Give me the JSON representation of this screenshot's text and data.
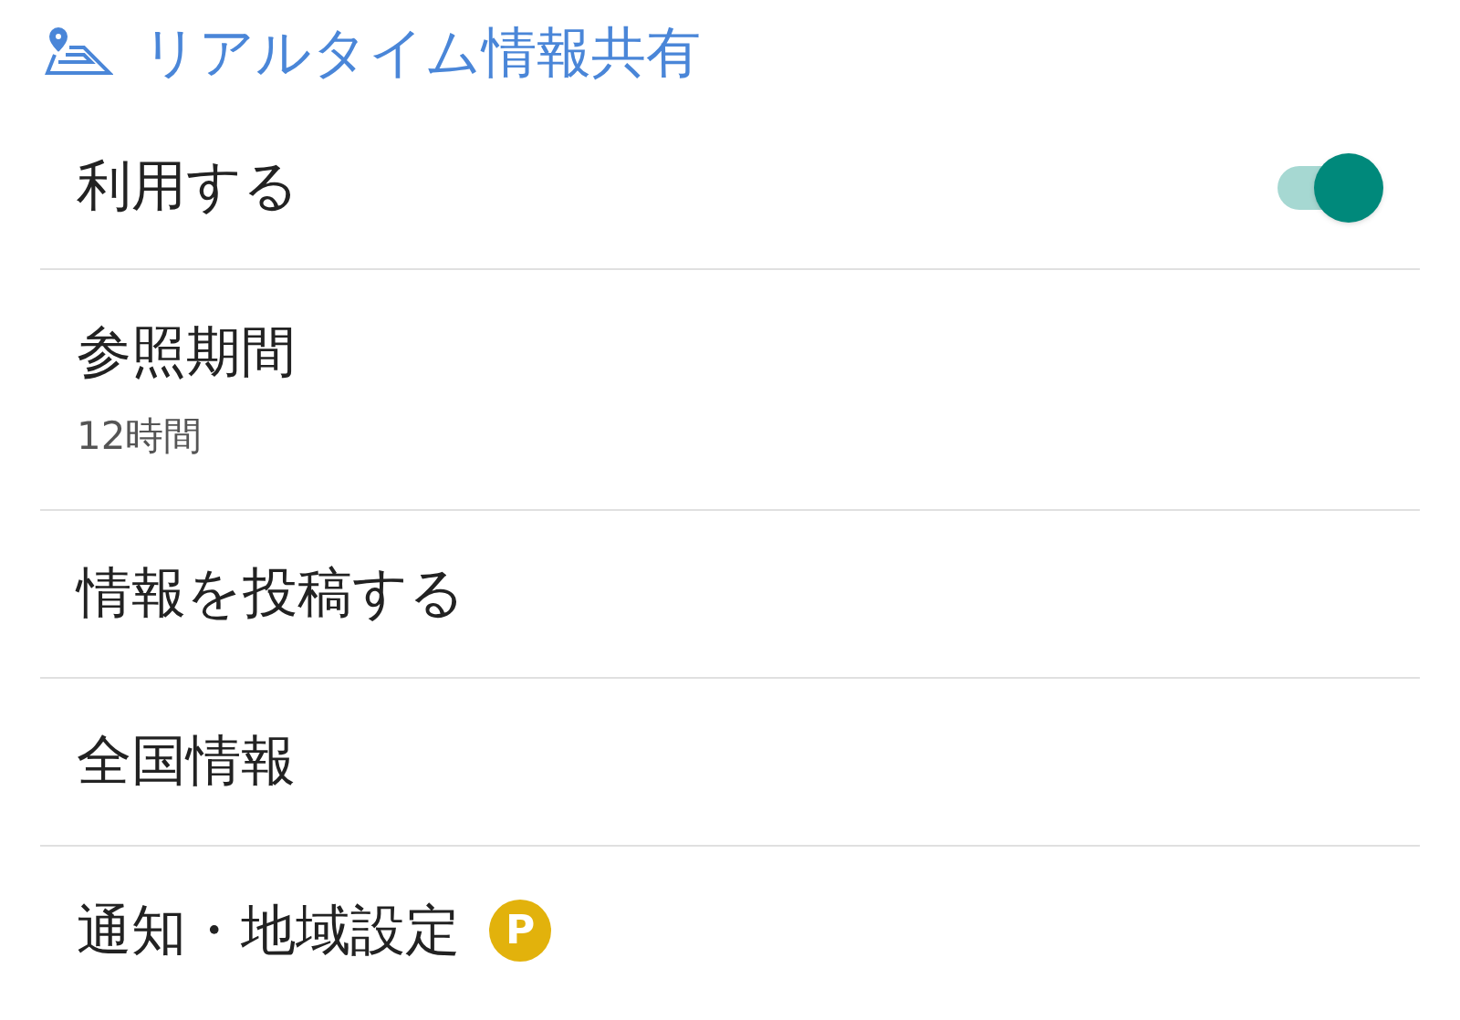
{
  "header": {
    "title": "リアルタイム情報共有"
  },
  "items": [
    {
      "kind": "toggle",
      "label": "利用する",
      "on": true
    },
    {
      "kind": "value",
      "label": "参照期間",
      "value": "12時間"
    },
    {
      "kind": "plain",
      "label": "情報を投稿する"
    },
    {
      "kind": "plain",
      "label": "全国情報"
    },
    {
      "kind": "badge",
      "label": "通知・地域設定",
      "badge": "P"
    }
  ]
}
